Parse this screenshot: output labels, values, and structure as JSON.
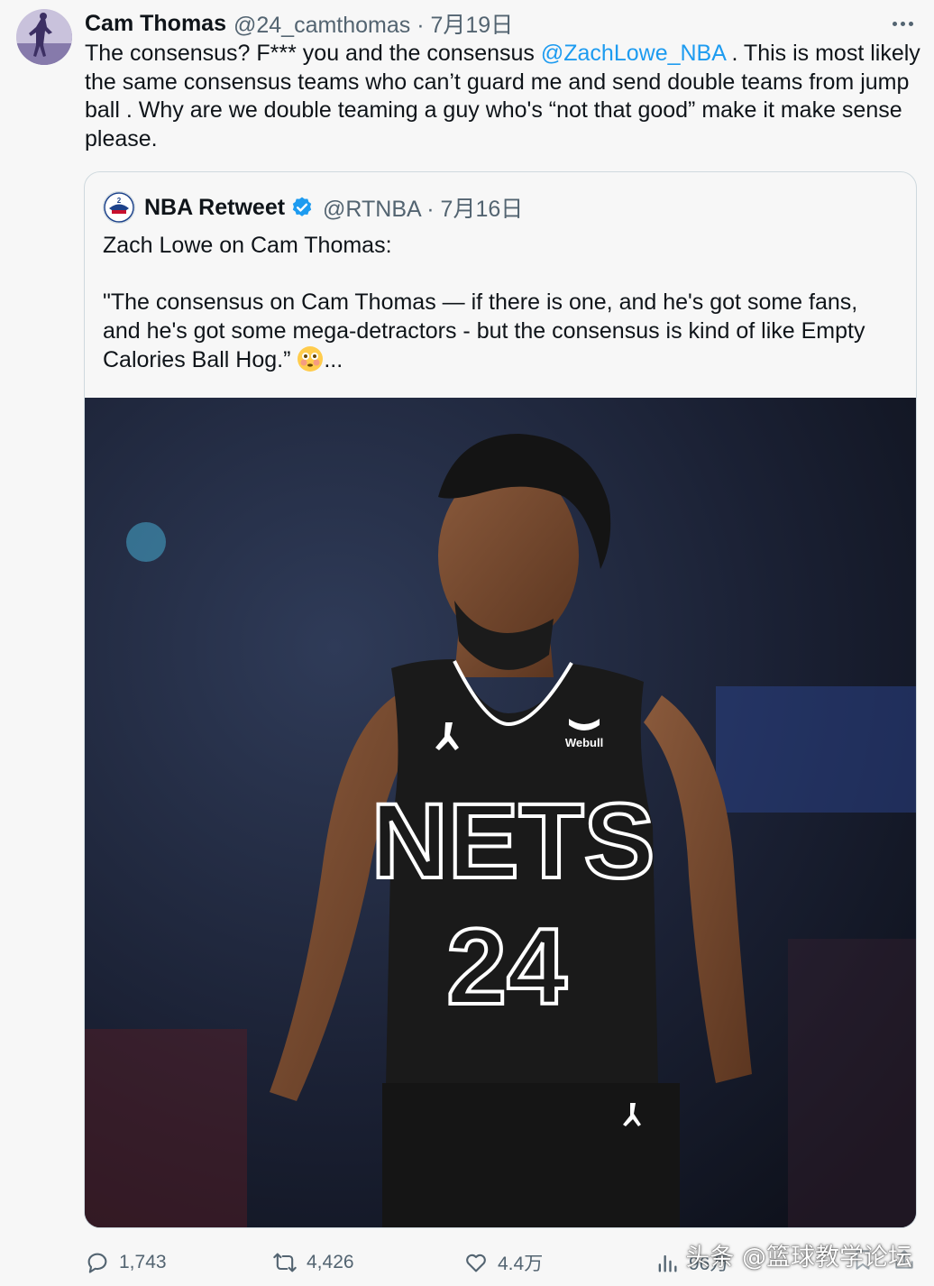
{
  "tweet": {
    "author_name": "Cam Thomas",
    "author_handle": "@24_camthomas · 7月19日",
    "text_before_mention": "The consensus? F*** you and the consensus ",
    "mention": "@ZachLowe_NBA",
    "text_after_mention": " . This is most likely the same consensus teams who can’t guard me and send double teams from jump ball . Why are we double teaming a guy who's “not that good” make it make sense please."
  },
  "quote": {
    "author_name": "NBA Retweet",
    "author_handle": "@RTNBA · 7月16日",
    "line1": "Zach Lowe on Cam Thomas:",
    "line2": "\"The consensus on Cam Thomas — if there is one, and he's got some fans, and he's got some mega-detractors - but the consensus is kind of like Empty Calories Ball Hog.” ",
    "ellipsis": "...",
    "image": {
      "jersey_team": "NETS",
      "jersey_number": "24",
      "jersey_sponsor": "Webull"
    }
  },
  "actions": {
    "replies": "1,743",
    "retweets": "4,426",
    "likes": "4.4万",
    "views": "96万"
  },
  "watermark": "头条 @篮球教学论坛",
  "colors": {
    "link": "#1d9bf0",
    "secondary_text": "#536471",
    "verified": "#1d9bf0"
  }
}
